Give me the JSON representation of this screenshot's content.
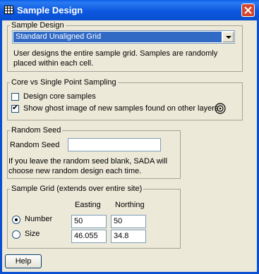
{
  "window": {
    "title": "Sample Design"
  },
  "sample_design": {
    "legend": "Sample Design",
    "selected_option": "Standard Unaligned Grid",
    "description": "User designs the entire sample grid. Samples are randomly placed within each cell."
  },
  "core_sampling": {
    "legend": "Core vs Single Point Sampling",
    "design_core_label": "Design core samples",
    "design_core_checked": false,
    "ghost_label": "Show ghost image of new samples found on other layers",
    "ghost_checked": true
  },
  "random_seed": {
    "legend": "Random Seed",
    "label": "Random Seed",
    "value": "",
    "note": "If you leave the random seed blank, SADA will choose new random design each time."
  },
  "sample_grid": {
    "legend": "Sample Grid (extends over entire site)",
    "col_easting": "Easting",
    "col_northing": "Northing",
    "number_label": "Number",
    "number_easting": "50",
    "number_northing": "50",
    "size_label": "Size",
    "size_easting": "46.055",
    "size_northing": "34.8",
    "selected": "Number"
  },
  "buttons": {
    "help": "Help"
  },
  "icons": {
    "window": "window-app-icon",
    "close": "close-icon",
    "target": "target-icon"
  },
  "colors": {
    "titlebar": "#0a5ee9",
    "close": "#d7452d",
    "selection": "#316ac5"
  }
}
